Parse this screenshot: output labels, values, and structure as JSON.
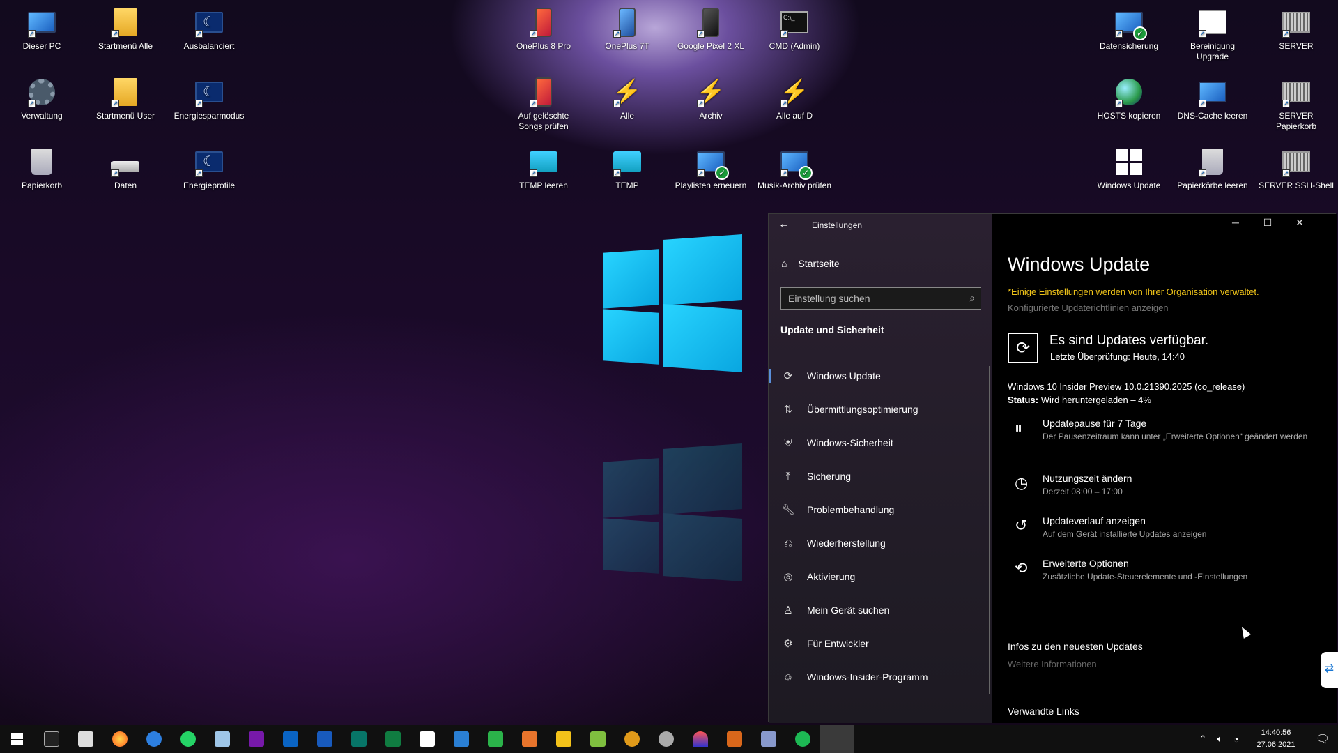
{
  "desktop": {
    "icons": [
      {
        "label": "Dieser PC",
        "icon": "this-pc-icon"
      },
      {
        "label": "Startmenü Alle",
        "icon": "folder-icon"
      },
      {
        "label": "Ausbalanciert",
        "icon": "power-plan-icon"
      },
      {
        "label": "Verwaltung",
        "icon": "gear-icon"
      },
      {
        "label": "Startmenü User",
        "icon": "folder-icon"
      },
      {
        "label": "Energiesparmodus",
        "icon": "power-plan-icon"
      },
      {
        "label": "Papierkorb",
        "icon": "recycle-bin-icon"
      },
      {
        "label": "Daten",
        "icon": "drive-icon"
      },
      {
        "label": "Energieprofile",
        "icon": "power-plan-icon"
      },
      {
        "label": "OnePlus 8 Pro",
        "icon": "phone-icon"
      },
      {
        "label": "OnePlus 7T",
        "icon": "phone-icon"
      },
      {
        "label": "Google Pixel 2 XL",
        "icon": "phone-icon"
      },
      {
        "label": "CMD (Admin)",
        "icon": "cmd-icon"
      },
      {
        "label": "Auf gelöschte Songs prüfen",
        "icon": "phone-icon"
      },
      {
        "label": "Alle",
        "icon": "winamp-icon"
      },
      {
        "label": "Archiv",
        "icon": "winamp-icon"
      },
      {
        "label": "Alle auf D",
        "icon": "winamp-icon"
      },
      {
        "label": "TEMP leeren",
        "icon": "folder-icon"
      },
      {
        "label": "TEMP",
        "icon": "folder-icon"
      },
      {
        "label": "Playlisten erneuern",
        "icon": "check-script-icon"
      },
      {
        "label": "Musik-Archiv prüfen",
        "icon": "check-script-icon"
      },
      {
        "label": "Datensicherung",
        "icon": "check-script-icon"
      },
      {
        "label": "Bereinigung Upgrade",
        "icon": "document-icon"
      },
      {
        "label": "SERVER",
        "icon": "server-icon"
      },
      {
        "label": "HOSTS kopieren",
        "icon": "globe-icon"
      },
      {
        "label": "DNS-Cache leeren",
        "icon": "monitor-icon"
      },
      {
        "label": "SERVER Papierkorb",
        "icon": "server-icon"
      },
      {
        "label": "Windows Update",
        "icon": "windows-icon"
      },
      {
        "label": "Papierkörbe leeren",
        "icon": "recycle-bin-icon"
      },
      {
        "label": "SERVER SSH-Shell",
        "icon": "server-icon"
      }
    ]
  },
  "settings": {
    "window_title": "Einstellungen",
    "home": "Startseite",
    "search_placeholder": "Einstellung suchen",
    "section": "Update und Sicherheit",
    "nav": [
      {
        "label": "Windows Update",
        "icon": "sync-icon"
      },
      {
        "label": "Übermittlungsoptimierung",
        "icon": "delivery-icon"
      },
      {
        "label": "Windows-Sicherheit",
        "icon": "shield-icon"
      },
      {
        "label": "Sicherung",
        "icon": "backup-icon"
      },
      {
        "label": "Problembehandlung",
        "icon": "wrench-icon"
      },
      {
        "label": "Wiederherstellung",
        "icon": "recovery-icon"
      },
      {
        "label": "Aktivierung",
        "icon": "check-circle-icon"
      },
      {
        "label": "Mein Gerät suchen",
        "icon": "person-icon"
      },
      {
        "label": "Für Entwickler",
        "icon": "developer-icon"
      },
      {
        "label": "Windows-Insider-Programm",
        "icon": "insider-icon"
      }
    ],
    "content": {
      "title": "Windows Update",
      "org_notice": "*Einige Einstellungen werden von Ihrer Organisation verwaltet.",
      "policies_link": "Konfigurierte Updaterichtlinien anzeigen",
      "available": "Es sind Updates verfügbar.",
      "last_check": "Letzte Überprüfung: Heute, 14:40",
      "version": "Windows 10 Insider Preview 10.0.21390.2025 (co_release)",
      "status_label": "Status:",
      "status_value": "Wird heruntergeladen – 4%",
      "download_progress_percent": 4,
      "options": [
        {
          "title": "Updatepause für 7 Tage",
          "sub": "Der Pausenzeitraum kann unter „Erweiterte Optionen“ geändert werden",
          "icon": "pause-icon"
        },
        {
          "title": "Nutzungszeit ändern",
          "sub": "Derzeit 08:00 – 17:00",
          "icon": "clock-icon"
        },
        {
          "title": "Updateverlauf anzeigen",
          "sub": "Auf dem Gerät installierte Updates anzeigen",
          "icon": "history-icon"
        },
        {
          "title": "Erweiterte Optionen",
          "sub": "Zusätzliche Update-Steuerelemente und -Einstellungen",
          "icon": "advanced-sync-icon"
        }
      ],
      "info_heading": "Infos zu den neuesten Updates",
      "info_link": "Weitere Informationen",
      "related": "Verwandte Links"
    }
  },
  "taskbar": {
    "apps": [
      "start-icon",
      "terminal-icon",
      "explorer-icon",
      "firefox-icon",
      "thunderbird-icon",
      "whatsapp-icon",
      "notepad-icon",
      "onenote-icon",
      "outlook-icon",
      "word-icon",
      "publisher-icon",
      "excel-icon",
      "file-icon",
      "writer-icon",
      "calc-icon",
      "impress-icon",
      "draw-icon",
      "spreadsheet-icon",
      "winamp-icon",
      "shield-app-icon",
      "vpn-icon",
      "tool-icon",
      "explorer2-icon",
      "spotify-icon",
      "settings-app-icon"
    ],
    "time": "14:40:56",
    "date": "27.06.2021"
  }
}
